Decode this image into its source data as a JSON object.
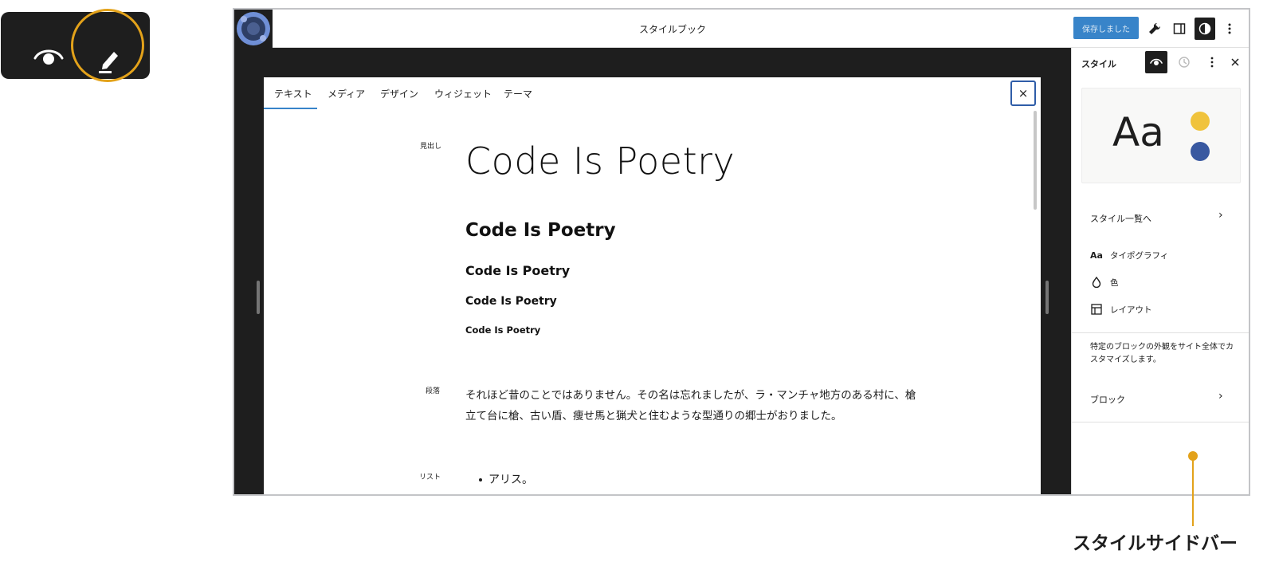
{
  "toolbar_callout": {
    "icons": [
      "eye-icon",
      "pencil-icon"
    ],
    "highlight_color": "#e3a21a"
  },
  "header": {
    "title": "スタイルブック",
    "save_label": "保存しました",
    "icons": [
      "wrench-icon",
      "sidebar-toggle-icon",
      "contrast-icon",
      "more-vertical-icon"
    ]
  },
  "stylebook": {
    "tabs": [
      {
        "label": "テキスト",
        "active": true
      },
      {
        "label": "メディア"
      },
      {
        "label": "デザイン"
      },
      {
        "label": "ウィジェット"
      },
      {
        "label": "テーマ"
      }
    ],
    "close_label": "×",
    "sections": {
      "heading_label": "見出し",
      "paragraph_label": "段落",
      "list_label": "リスト"
    },
    "headings": {
      "h1": "Code Is Poetry",
      "h2": "Code Is Poetry",
      "h3": "Code Is Poetry",
      "h4": "Code Is Poetry",
      "h5": "Code Is Poetry"
    },
    "paragraph": "それほど昔のことではありません。その名は忘れましたが、ラ・マンチャ地方のある村に、槍立て台に槍、古い盾、痩せ馬と猟犬と住むような型通りの郷士がおりました。",
    "list_items": [
      "アリス。"
    ]
  },
  "sidebar": {
    "title": "スタイル",
    "preview": {
      "sample_text": "Aa",
      "colors": [
        "#f0c33c",
        "#3858a0"
      ]
    },
    "browse_styles": "スタイル一覧へ",
    "nav": [
      {
        "icon": "typography-icon",
        "glyph": "Aa",
        "label": "タイポグラフィ"
      },
      {
        "icon": "color-droplet-icon",
        "label": "色"
      },
      {
        "icon": "layout-icon",
        "label": "レイアウト"
      }
    ],
    "blocks_description": "特定のブロックの外観をサイト全体でカスタマイズします。",
    "blocks_label": "ブロック"
  },
  "callout": {
    "label": "スタイルサイドバー",
    "color": "#e3a21a"
  }
}
